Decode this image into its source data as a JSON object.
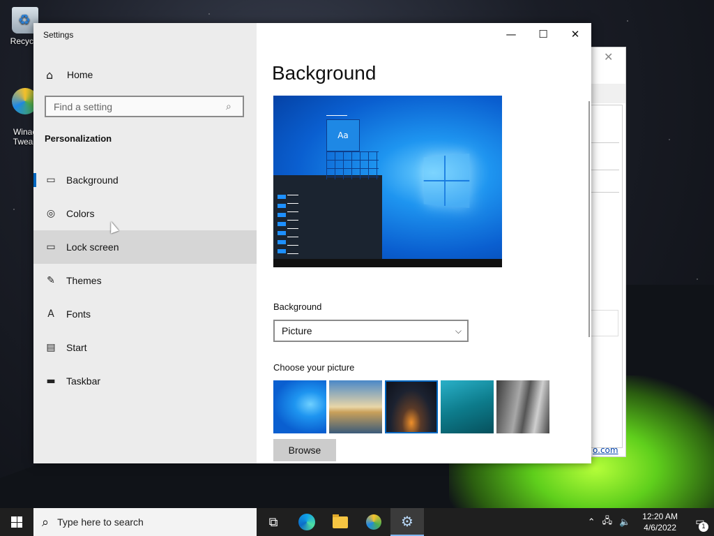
{
  "desktop": {
    "icons": [
      {
        "label": "Recycle"
      },
      {
        "label": "Winae\nTweak"
      }
    ]
  },
  "bg_window": {
    "link": "o.com"
  },
  "settings": {
    "title": "Settings",
    "home_label": "Home",
    "search_placeholder": "Find a setting",
    "section": "Personalization",
    "nav": [
      {
        "label": "Background",
        "icon": "picture-icon",
        "active": true
      },
      {
        "label": "Colors",
        "icon": "palette-icon"
      },
      {
        "label": "Lock screen",
        "icon": "lock-screen-icon",
        "hover": true
      },
      {
        "label": "Themes",
        "icon": "themes-icon"
      },
      {
        "label": "Fonts",
        "icon": "fonts-icon"
      },
      {
        "label": "Start",
        "icon": "start-icon"
      },
      {
        "label": "Taskbar",
        "icon": "taskbar-icon"
      }
    ],
    "page_title": "Background",
    "preview_tile_text": "Aa",
    "background_label": "Background",
    "background_value": "Picture",
    "choose_label": "Choose your picture",
    "browse_label": "Browse",
    "accent": "#0067c0"
  },
  "taskbar": {
    "search_text": "Type here to search",
    "time": "12:20 AM",
    "date": "4/6/2022",
    "notif_count": "1"
  }
}
